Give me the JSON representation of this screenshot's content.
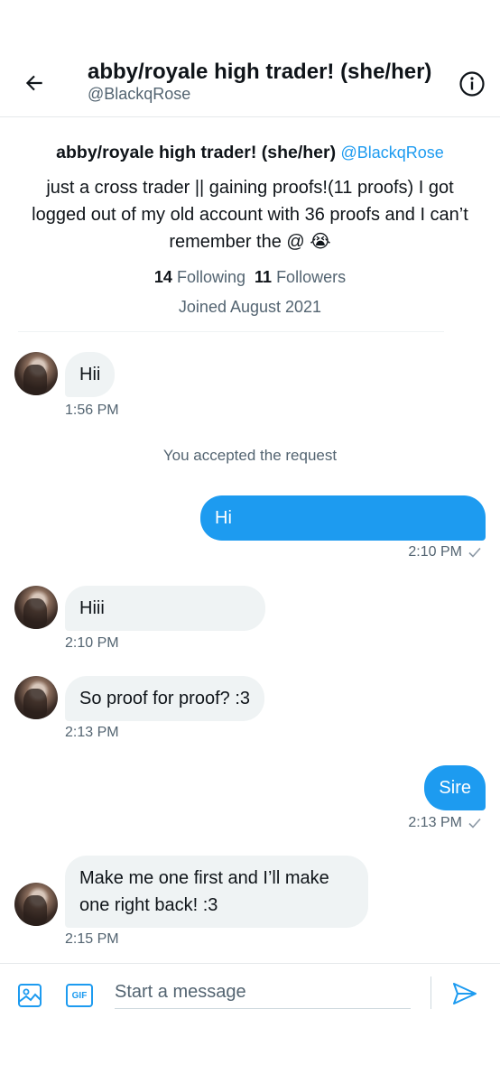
{
  "header": {
    "title": "abby/royale high trader! (she/her)",
    "handle": "@BlackqRose"
  },
  "profile": {
    "name": "abby/royale high trader! (she/her)",
    "handle": "@BlackqRose",
    "bio": "just a cross trader || gaining proofs!(11 proofs) I got logged out of my old account with 36 proofs and I can’t remember the @ 😭",
    "following_count": "14",
    "following_label": "Following",
    "followers_count": "11",
    "followers_label": "Followers",
    "joined": "Joined August 2021"
  },
  "messages": [
    {
      "from": "them",
      "text": "Hii",
      "time": "1:56 PM"
    },
    {
      "from": "system",
      "text": "You accepted the request"
    },
    {
      "from": "me",
      "text": "Hi",
      "time": "2:10 PM"
    },
    {
      "from": "them",
      "text": "Hiii",
      "time": "2:10 PM"
    },
    {
      "from": "them",
      "text": "So proof for proof? :3",
      "time": "2:13 PM"
    },
    {
      "from": "me",
      "text": "Sire",
      "time": "2:13 PM"
    },
    {
      "from": "them",
      "text": "Make me one first and I’ll make one right back! :3",
      "time": "2:15 PM"
    }
  ],
  "composer": {
    "placeholder": "Start a message",
    "gif_label": "GIF"
  },
  "colors": {
    "accent": "#1d9bf0",
    "bubble_in": "#eff3f4",
    "muted_text": "#536471"
  }
}
